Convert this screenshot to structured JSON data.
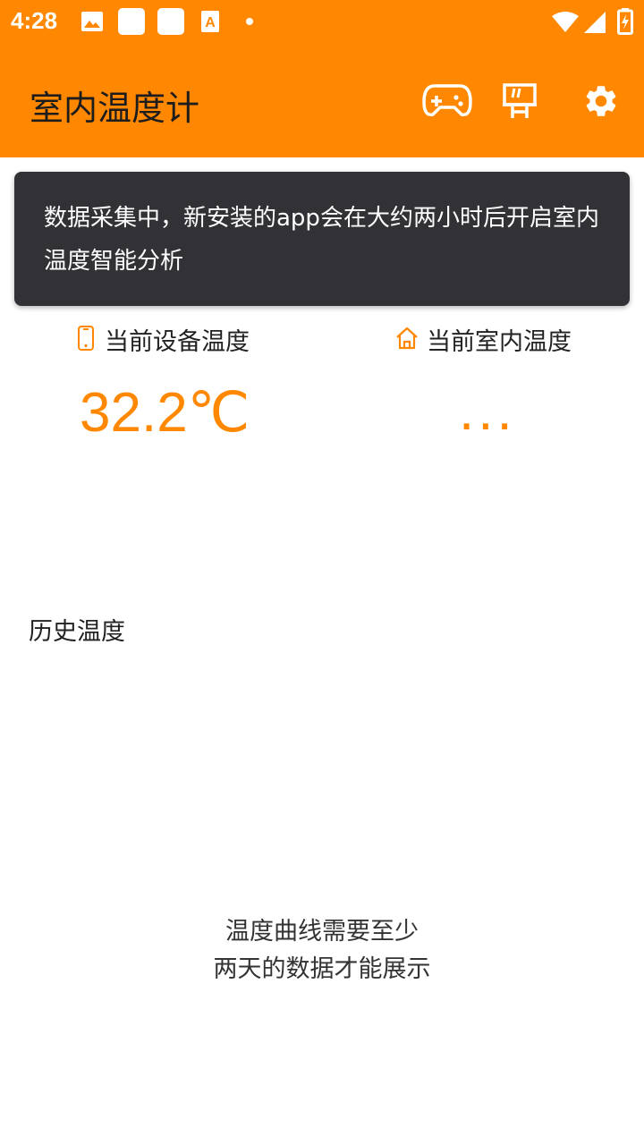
{
  "status_bar": {
    "time": "4:28",
    "notification_icons": [
      "image-icon",
      "app-icon",
      "app-icon",
      "font-icon",
      "dot-icon"
    ],
    "system_icons": [
      "wifi-icon",
      "signal-icon",
      "battery-charging-icon"
    ]
  },
  "app_bar": {
    "title": "室内温度计",
    "actions": [
      "gamepad-icon",
      "billboard-icon",
      "settings-icon"
    ],
    "color": "#FF8800"
  },
  "toast": {
    "message": "数据采集中，新安装的app会在大约两小时后开启室内温度智能分析"
  },
  "readings": {
    "device": {
      "label": "当前设备温度",
      "value": "32.2℃",
      "icon": "phone-icon"
    },
    "indoor": {
      "label": "当前室内温度",
      "value": "...",
      "icon": "home-icon"
    }
  },
  "history": {
    "title": "历史温度",
    "empty_line1": "温度曲线需要至少",
    "empty_line2": "两天的数据才能展示"
  }
}
